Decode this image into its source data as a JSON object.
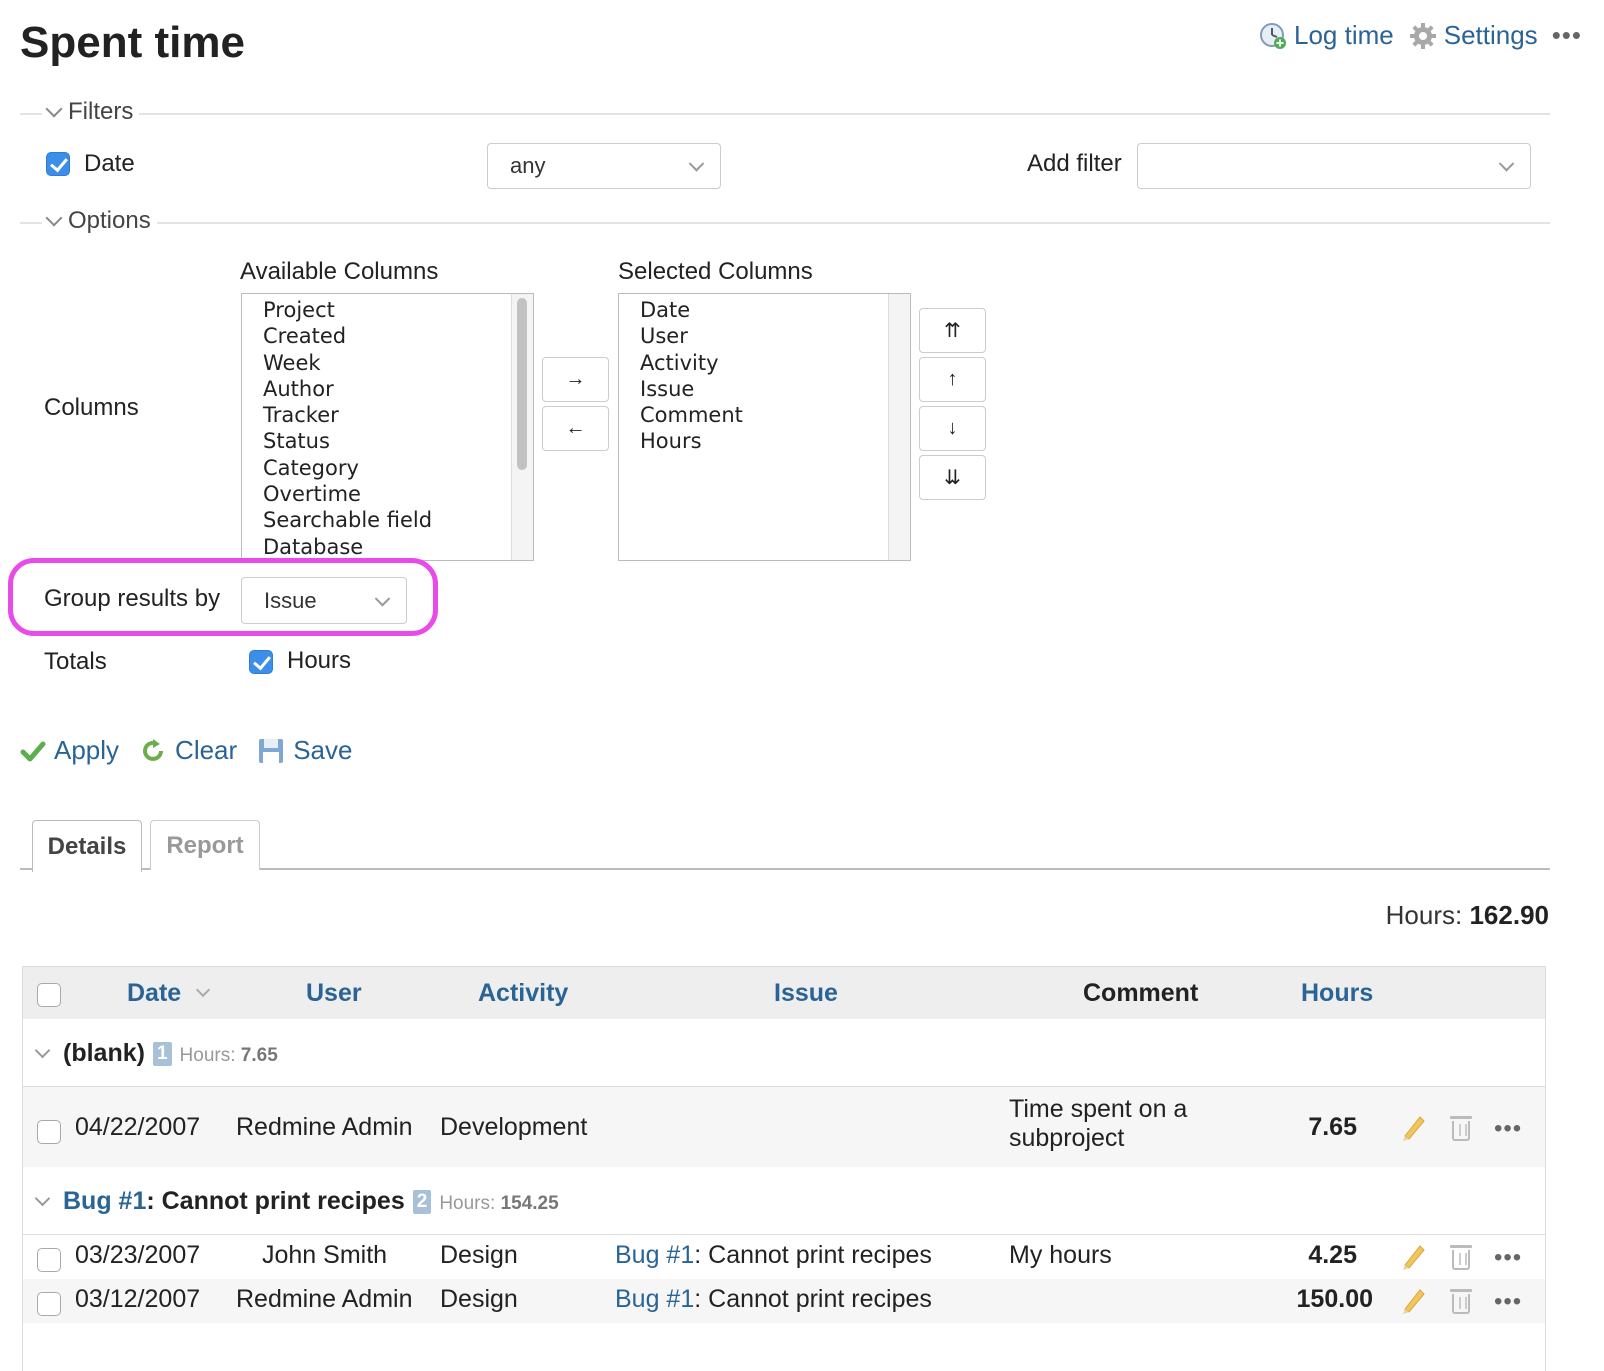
{
  "page": {
    "title": "Spent time"
  },
  "contextual": {
    "log_time": "Log time",
    "settings": "Settings",
    "more": "•••"
  },
  "filters": {
    "legend": "Filters",
    "date_label": "Date",
    "date_operator": "any",
    "add_filter_label": "Add filter",
    "add_filter_value": ""
  },
  "options": {
    "legend": "Options",
    "columns_label": "Columns",
    "available_title": "Available Columns",
    "available": [
      "Project",
      "Created",
      "Week",
      "Author",
      "Tracker",
      "Status",
      "Category",
      "Overtime",
      "Searchable field",
      "Database"
    ],
    "selected_title": "Selected Columns",
    "selected": [
      "Date",
      "User",
      "Activity",
      "Issue",
      "Comment",
      "Hours"
    ],
    "move_right": "→",
    "move_left": "←",
    "move_top": "⇈",
    "move_up": "↑",
    "move_down": "↓",
    "move_bottom": "⇊",
    "group_by_label": "Group results by",
    "group_by_value": "Issue",
    "totals_label": "Totals",
    "totals_hours": "Hours"
  },
  "actions": {
    "apply": "Apply",
    "clear": "Clear",
    "save": "Save"
  },
  "tabs": {
    "details": "Details",
    "report": "Report"
  },
  "total": {
    "label": "Hours:",
    "value": "162.90"
  },
  "table": {
    "headers": {
      "date": "Date",
      "user": "User",
      "activity": "Activity",
      "issue": "Issue",
      "comment": "Comment",
      "hours": "Hours"
    },
    "groups": [
      {
        "name": "(blank)",
        "count": "1",
        "hours_label": "Hours:",
        "hours": "7.65",
        "rows": [
          {
            "date": "04/22/2007",
            "user": "Redmine Admin",
            "activity": "Development",
            "issue_link": "",
            "issue_title": "",
            "comment_line1": "Time spent on a",
            "comment_line2": "subproject",
            "hours": "7.65"
          }
        ]
      },
      {
        "name_link": "Bug #1",
        "name_title": ": Cannot print recipes",
        "count": "2",
        "hours_label": "Hours:",
        "hours": "154.25",
        "rows": [
          {
            "date": "03/23/2007",
            "user": "John Smith",
            "activity": "Design",
            "issue_link": "Bug #1",
            "issue_title": ": Cannot print recipes",
            "comment": "My hours",
            "hours": "4.25"
          },
          {
            "date": "03/12/2007",
            "user": "Redmine Admin",
            "activity": "Design",
            "issue_link": "Bug #1",
            "issue_title": ": Cannot print recipes",
            "comment": "",
            "hours": "150.00"
          }
        ]
      }
    ]
  },
  "colors": {
    "link": "#2a6496",
    "checkbox": "#3c8ee8",
    "highlight": "#e84be8"
  }
}
